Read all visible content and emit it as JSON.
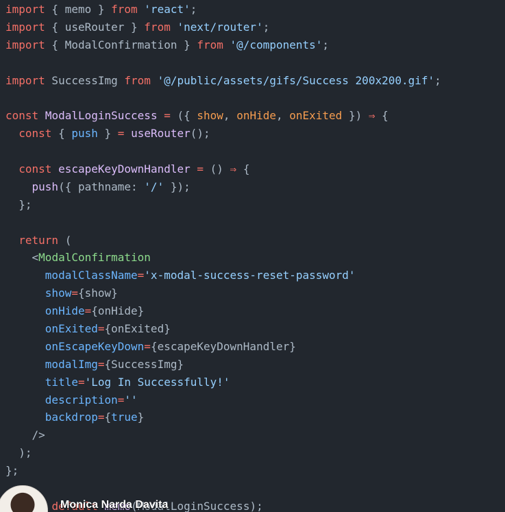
{
  "colors": {
    "background": "#22272e",
    "keyword": "#f47067",
    "string": "#96d0ff",
    "function": "#dcbdfb",
    "parameter": "#f69d50",
    "jsx_tag": "#8ddb8c",
    "jsx_attribute": "#6cb6ff",
    "plain": "#adbac7"
  },
  "code_lines": [
    [
      {
        "t": "import",
        "c": "keyword"
      },
      {
        "t": " { memo } ",
        "c": "plain"
      },
      {
        "t": "from",
        "c": "keyword"
      },
      {
        "t": " ",
        "c": "plain"
      },
      {
        "t": "'react'",
        "c": "string"
      },
      {
        "t": ";",
        "c": "plain"
      }
    ],
    [
      {
        "t": "import",
        "c": "keyword"
      },
      {
        "t": " { useRouter } ",
        "c": "plain"
      },
      {
        "t": "from",
        "c": "keyword"
      },
      {
        "t": " ",
        "c": "plain"
      },
      {
        "t": "'next/router'",
        "c": "string"
      },
      {
        "t": ";",
        "c": "plain"
      }
    ],
    [
      {
        "t": "import",
        "c": "keyword"
      },
      {
        "t": " { ModalConfirmation } ",
        "c": "plain"
      },
      {
        "t": "from",
        "c": "keyword"
      },
      {
        "t": " ",
        "c": "plain"
      },
      {
        "t": "'@/components'",
        "c": "string"
      },
      {
        "t": ";",
        "c": "plain"
      }
    ],
    [],
    [
      {
        "t": "import",
        "c": "keyword"
      },
      {
        "t": " SuccessImg ",
        "c": "plain"
      },
      {
        "t": "from",
        "c": "keyword"
      },
      {
        "t": " ",
        "c": "plain"
      },
      {
        "t": "'@/public/assets/gifs/Success 200x200.gif'",
        "c": "string"
      },
      {
        "t": ";",
        "c": "plain"
      }
    ],
    [],
    [
      {
        "t": "const",
        "c": "keyword"
      },
      {
        "t": " ",
        "c": "plain"
      },
      {
        "t": "ModalLoginSuccess",
        "c": "func"
      },
      {
        "t": " ",
        "c": "plain"
      },
      {
        "t": "=",
        "c": "keyword"
      },
      {
        "t": " ({ ",
        "c": "plain"
      },
      {
        "t": "show",
        "c": "param"
      },
      {
        "t": ", ",
        "c": "plain"
      },
      {
        "t": "onHide",
        "c": "param"
      },
      {
        "t": ", ",
        "c": "plain"
      },
      {
        "t": "onExited",
        "c": "param"
      },
      {
        "t": " }) ",
        "c": "plain"
      },
      {
        "t": "⇒",
        "c": "keyword"
      },
      {
        "t": " {",
        "c": "plain"
      }
    ],
    [
      {
        "t": "  ",
        "c": "plain"
      },
      {
        "t": "const",
        "c": "keyword"
      },
      {
        "t": " { ",
        "c": "plain"
      },
      {
        "t": "push",
        "c": "attr"
      },
      {
        "t": " } ",
        "c": "plain"
      },
      {
        "t": "=",
        "c": "keyword"
      },
      {
        "t": " ",
        "c": "plain"
      },
      {
        "t": "useRouter",
        "c": "func"
      },
      {
        "t": "();",
        "c": "plain"
      }
    ],
    [],
    [
      {
        "t": "  ",
        "c": "plain"
      },
      {
        "t": "const",
        "c": "keyword"
      },
      {
        "t": " ",
        "c": "plain"
      },
      {
        "t": "escapeKeyDownHandler",
        "c": "func"
      },
      {
        "t": " ",
        "c": "plain"
      },
      {
        "t": "=",
        "c": "keyword"
      },
      {
        "t": " () ",
        "c": "plain"
      },
      {
        "t": "⇒",
        "c": "keyword"
      },
      {
        "t": " {",
        "c": "plain"
      }
    ],
    [
      {
        "t": "    ",
        "c": "plain"
      },
      {
        "t": "push",
        "c": "func"
      },
      {
        "t": "({ pathname: ",
        "c": "plain"
      },
      {
        "t": "'/'",
        "c": "string"
      },
      {
        "t": " });",
        "c": "plain"
      }
    ],
    [
      {
        "t": "  };",
        "c": "plain"
      }
    ],
    [],
    [
      {
        "t": "  ",
        "c": "plain"
      },
      {
        "t": "return",
        "c": "keyword"
      },
      {
        "t": " (",
        "c": "plain"
      }
    ],
    [
      {
        "t": "    <",
        "c": "plain"
      },
      {
        "t": "ModalConfirmation",
        "c": "tag"
      }
    ],
    [
      {
        "t": "      ",
        "c": "plain"
      },
      {
        "t": "modalClassName",
        "c": "attr"
      },
      {
        "t": "=",
        "c": "keyword"
      },
      {
        "t": "'x-modal-success-reset-password'",
        "c": "string"
      }
    ],
    [
      {
        "t": "      ",
        "c": "plain"
      },
      {
        "t": "show",
        "c": "attr"
      },
      {
        "t": "=",
        "c": "keyword"
      },
      {
        "t": "{show}",
        "c": "plain"
      }
    ],
    [
      {
        "t": "      ",
        "c": "plain"
      },
      {
        "t": "onHide",
        "c": "attr"
      },
      {
        "t": "=",
        "c": "keyword"
      },
      {
        "t": "{onHide}",
        "c": "plain"
      }
    ],
    [
      {
        "t": "      ",
        "c": "plain"
      },
      {
        "t": "onExited",
        "c": "attr"
      },
      {
        "t": "=",
        "c": "keyword"
      },
      {
        "t": "{onExited}",
        "c": "plain"
      }
    ],
    [
      {
        "t": "      ",
        "c": "plain"
      },
      {
        "t": "onEscapeKeyDown",
        "c": "attr"
      },
      {
        "t": "=",
        "c": "keyword"
      },
      {
        "t": "{escapeKeyDownHandler}",
        "c": "plain"
      }
    ],
    [
      {
        "t": "      ",
        "c": "plain"
      },
      {
        "t": "modalImg",
        "c": "attr"
      },
      {
        "t": "=",
        "c": "keyword"
      },
      {
        "t": "{SuccessImg}",
        "c": "plain"
      }
    ],
    [
      {
        "t": "      ",
        "c": "plain"
      },
      {
        "t": "title",
        "c": "attr"
      },
      {
        "t": "=",
        "c": "keyword"
      },
      {
        "t": "'Log In Successfully!'",
        "c": "string"
      }
    ],
    [
      {
        "t": "      ",
        "c": "plain"
      },
      {
        "t": "description",
        "c": "attr"
      },
      {
        "t": "=",
        "c": "keyword"
      },
      {
        "t": "''",
        "c": "string"
      }
    ],
    [
      {
        "t": "      ",
        "c": "plain"
      },
      {
        "t": "backdrop",
        "c": "attr"
      },
      {
        "t": "=",
        "c": "keyword"
      },
      {
        "t": "{",
        "c": "plain"
      },
      {
        "t": "true",
        "c": "attr"
      },
      {
        "t": "}",
        "c": "plain"
      }
    ],
    [
      {
        "t": "    />",
        "c": "plain"
      }
    ],
    [
      {
        "t": "  );",
        "c": "plain"
      }
    ],
    [
      {
        "t": "};",
        "c": "plain"
      }
    ],
    [],
    [
      {
        "t": "export",
        "c": "keyword"
      },
      {
        "t": " ",
        "c": "plain"
      },
      {
        "t": "default",
        "c": "keyword"
      },
      {
        "t": " ",
        "c": "plain"
      },
      {
        "t": "memo",
        "c": "func"
      },
      {
        "t": "(",
        "c": "plain"
      },
      {
        "t": "ModalLoginSuccess",
        "c": "plain"
      },
      {
        "t": ");",
        "c": "plain"
      }
    ]
  ],
  "author": {
    "name": "Monica Narda Davita"
  }
}
